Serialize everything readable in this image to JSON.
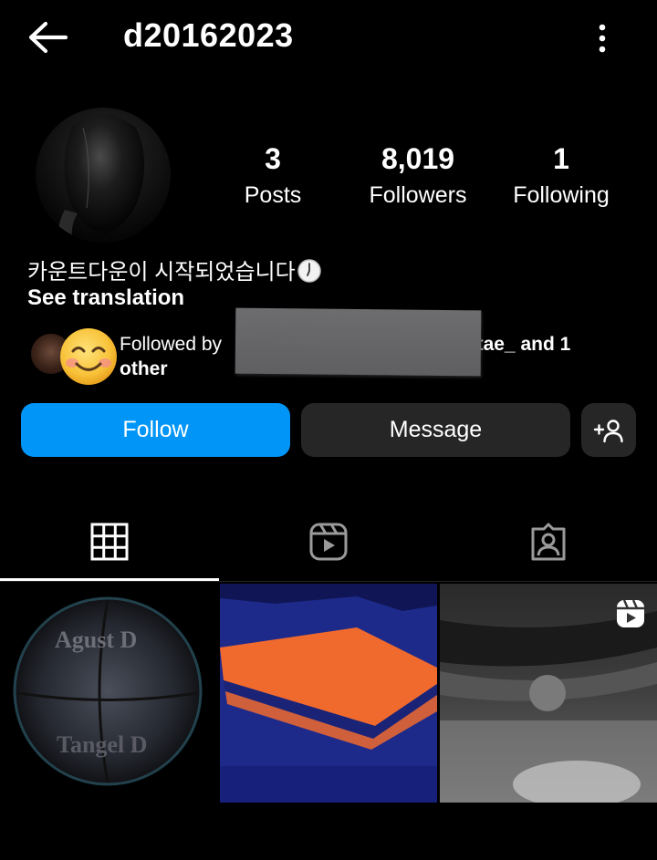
{
  "header": {
    "username": "d20162023"
  },
  "profile": {
    "stats": [
      {
        "value": "3",
        "label": "Posts"
      },
      {
        "value": "8,019",
        "label": "Followers"
      },
      {
        "value": "1",
        "label": "Following"
      }
    ],
    "bio": "카운트다운이 시작되었습니다",
    "see_translation": "See translation",
    "followed_by": {
      "prefix": "Followed by",
      "visible_name": "etae_",
      "suffix": " and 1 other"
    }
  },
  "actions": {
    "follow_label": "Follow",
    "message_label": "Message"
  },
  "colors": {
    "follow_button": "#0095f6",
    "secondary_button": "#262626",
    "background": "#000000"
  },
  "tabs": [
    {
      "icon": "grid-icon",
      "active": true
    },
    {
      "icon": "reels-icon",
      "active": false
    },
    {
      "icon": "tagged-icon",
      "active": false
    }
  ],
  "grid_posts": [
    {
      "type": "image",
      "icon": null
    },
    {
      "type": "image",
      "icon": null
    },
    {
      "type": "reel",
      "icon": "reel-badge-icon"
    }
  ]
}
